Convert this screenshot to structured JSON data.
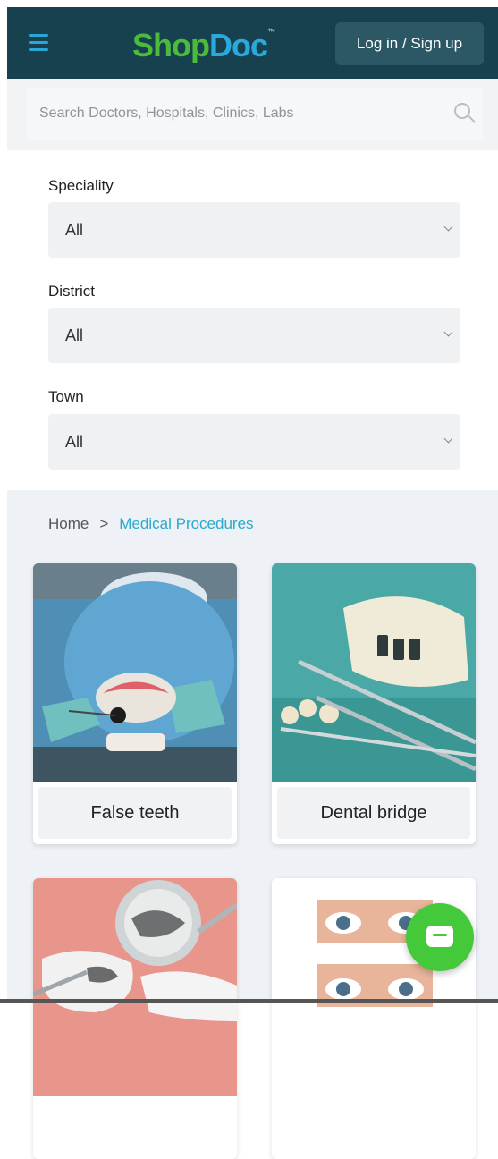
{
  "header": {
    "logo_shop": "Shop",
    "logo_doc": "Doc",
    "logo_tm": "™",
    "login_label": "Log in / Sign up"
  },
  "search": {
    "placeholder": "Search Doctors, Hospitals, Clinics, Labs"
  },
  "filters": [
    {
      "label": "Speciality",
      "value": "All"
    },
    {
      "label": "District",
      "value": "All"
    },
    {
      "label": "Town",
      "value": "All"
    }
  ],
  "breadcrumb": {
    "home": "Home",
    "separator": ">",
    "current": "Medical Procedures"
  },
  "cards": [
    {
      "label": "False teeth"
    },
    {
      "label": "Dental bridge"
    },
    {
      "label": ""
    },
    {
      "label": ""
    }
  ],
  "icons": {
    "menu": "hamburger-menu-icon",
    "search": "search-icon",
    "chat": "chat-icon"
  },
  "colors": {
    "header_bg": "#17414f",
    "logo_green": "#4cbb3c",
    "logo_blue": "#2aa9dd",
    "accent": "#2aa9c9",
    "chat_green": "#43c93a"
  }
}
